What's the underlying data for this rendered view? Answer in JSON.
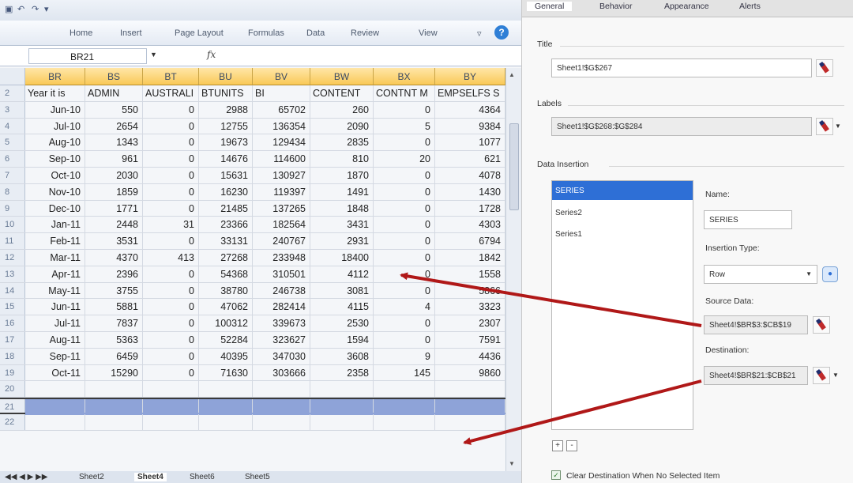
{
  "excel": {
    "tabs": [
      "Home",
      "Insert",
      "Page Layout",
      "Formulas",
      "Data",
      "Review",
      "View"
    ],
    "name_box": "BR21",
    "fx_label": "fx",
    "columns": [
      "BR",
      "BS",
      "BT",
      "BU",
      "BV",
      "BW",
      "BX",
      "BY"
    ],
    "header_row": {
      "num": "2",
      "cells": [
        "Year it is",
        "ADMIN",
        "AUSTRALI",
        "BTUNITS",
        "BI",
        "CONTENT",
        "CONTNT M",
        "EMPSELFS S"
      ]
    },
    "rows": [
      {
        "num": "3",
        "cells": [
          "Jun-10",
          "550",
          "0",
          "2988",
          "65702",
          "260",
          "0",
          "4364"
        ]
      },
      {
        "num": "4",
        "cells": [
          "Jul-10",
          "2654",
          "0",
          "12755",
          "136354",
          "2090",
          "5",
          "9384"
        ]
      },
      {
        "num": "5",
        "cells": [
          "Aug-10",
          "1343",
          "0",
          "19673",
          "129434",
          "2835",
          "0",
          "1077"
        ]
      },
      {
        "num": "6",
        "cells": [
          "Sep-10",
          "961",
          "0",
          "14676",
          "114600",
          "810",
          "20",
          "621"
        ]
      },
      {
        "num": "7",
        "cells": [
          "Oct-10",
          "2030",
          "0",
          "15631",
          "130927",
          "1870",
          "0",
          "4078"
        ]
      },
      {
        "num": "8",
        "cells": [
          "Nov-10",
          "1859",
          "0",
          "16230",
          "119397",
          "1491",
          "0",
          "1430"
        ]
      },
      {
        "num": "9",
        "cells": [
          "Dec-10",
          "1771",
          "0",
          "21485",
          "137265",
          "1848",
          "0",
          "1728"
        ]
      },
      {
        "num": "10",
        "cells": [
          "Jan-11",
          "2448",
          "31",
          "23366",
          "182564",
          "3431",
          "0",
          "4303"
        ]
      },
      {
        "num": "11",
        "cells": [
          "Feb-11",
          "3531",
          "0",
          "33131",
          "240767",
          "2931",
          "0",
          "6794"
        ]
      },
      {
        "num": "12",
        "cells": [
          "Mar-11",
          "4370",
          "413",
          "27268",
          "233948",
          "18400",
          "0",
          "1842"
        ]
      },
      {
        "num": "13",
        "cells": [
          "Apr-11",
          "2396",
          "0",
          "54368",
          "310501",
          "4112",
          "0",
          "1558"
        ]
      },
      {
        "num": "14",
        "cells": [
          "May-11",
          "3755",
          "0",
          "38780",
          "246738",
          "3081",
          "0",
          "5866"
        ]
      },
      {
        "num": "15",
        "cells": [
          "Jun-11",
          "5881",
          "0",
          "47062",
          "282414",
          "4115",
          "4",
          "3323"
        ]
      },
      {
        "num": "16",
        "cells": [
          "Jul-11",
          "7837",
          "0",
          "100312",
          "339673",
          "2530",
          "0",
          "2307"
        ]
      },
      {
        "num": "17",
        "cells": [
          "Aug-11",
          "5363",
          "0",
          "52284",
          "323627",
          "1594",
          "0",
          "7591"
        ]
      },
      {
        "num": "18",
        "cells": [
          "Sep-11",
          "6459",
          "0",
          "40395",
          "347030",
          "3608",
          "9",
          "4436"
        ]
      },
      {
        "num": "19",
        "cells": [
          "Oct-11",
          "15290",
          "0",
          "71630",
          "303666",
          "2358",
          "145",
          "9860"
        ]
      },
      {
        "num": "20",
        "cells": [
          "",
          "",
          "",
          "",
          "",
          "",
          "",
          ""
        ]
      },
      {
        "num": "21",
        "cells": [
          "",
          "",
          "",
          "",
          "",
          "",
          "",
          ""
        ]
      },
      {
        "num": "22",
        "cells": [
          "",
          "",
          "",
          "",
          "",
          "",
          "",
          ""
        ]
      }
    ],
    "sheet_tabs": [
      "Sheet2",
      "Sheet4",
      "Sheet6",
      "Sheet5"
    ]
  },
  "panel": {
    "tabs": [
      "General",
      "Behavior",
      "Appearance",
      "Alerts"
    ],
    "title_label": "Title",
    "title_value": "Sheet1!$G$267",
    "labels_label": "Labels",
    "labels_value": "Sheet1!$G$268:$G$284",
    "data_insertion_label": "Data Insertion",
    "series": [
      "SERIES",
      "Series2",
      "Series1"
    ],
    "name_label": "Name:",
    "name_value": "SERIES",
    "insertion_type_label": "Insertion Type:",
    "insertion_type_value": "Row",
    "source_data_label": "Source Data:",
    "source_data_value": "Sheet4!$BR$3:$CB$19",
    "destination_label": "Destination:",
    "destination_value": "Sheet4!$BR$21:$CB$21",
    "add_label": "+",
    "remove_label": "-",
    "clear_label": "Clear Destination When No Selected Item"
  },
  "colors": {
    "accent": "#2e6fd6",
    "arrow": "#b01818",
    "highlight": "#8ea3d8",
    "column_header": "#f9c957"
  }
}
